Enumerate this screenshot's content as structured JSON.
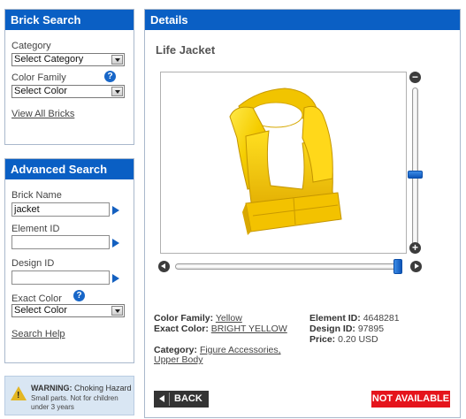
{
  "brick_search": {
    "title": "Brick Search",
    "category_label": "Category",
    "category_value": "Select Category",
    "color_family_label": "Color Family",
    "color_family_value": "Select Color",
    "help_glyph": "?",
    "view_all_link": "View All Bricks"
  },
  "advanced_search": {
    "title": "Advanced Search",
    "brick_name_label": "Brick Name",
    "brick_name_value": "jacket",
    "element_id_label": "Element ID",
    "element_id_value": "",
    "design_id_label": "Design ID",
    "design_id_value": "",
    "exact_color_label": "Exact Color",
    "exact_color_value": "Select Color",
    "help_glyph": "?",
    "search_help_link": "Search Help"
  },
  "warning": {
    "title_bold": "WARNING:",
    "title_rest": "Choking Hazard",
    "body": "Small parts. Not for children under 3 years",
    "icon": "warning-triangle-icon"
  },
  "details": {
    "title": "Details",
    "item_name": "Life Jacket",
    "zoom_out_glyph": "−",
    "zoom_in_glyph": "+",
    "zoom_level": 0.55,
    "rotation_level": 1.0,
    "color_family_label": "Color Family:",
    "color_family_value": "Yellow",
    "exact_color_label": "Exact Color:",
    "exact_color_value": "BRIGHT YELLOW",
    "category_label": "Category:",
    "category_value": "Figure Accessories, Upper Body",
    "element_id_label": "Element ID:",
    "element_id_value": "4648281",
    "design_id_label": "Design ID:",
    "design_id_value": "97895",
    "price_label": "Price:",
    "price_value": "0.20 USD",
    "back_label": "BACK",
    "status_badge": "NOT AVAILABLE"
  },
  "colors": {
    "header_blue": "#0a5fc4",
    "brick_yellow": "#f5cd00",
    "badge_red": "#e5141c",
    "slider_blue": "#1a6fd0"
  }
}
